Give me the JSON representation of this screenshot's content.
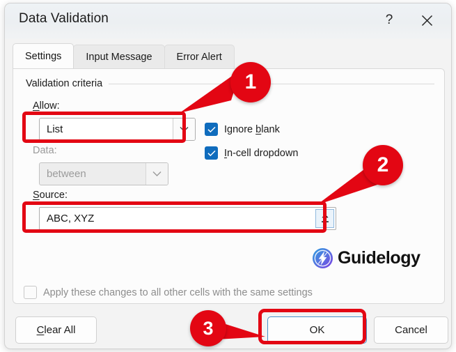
{
  "dialog": {
    "title": "Data Validation",
    "help_icon": "?",
    "help_icon_name": "help-icon",
    "close_icon": "close-icon"
  },
  "tabs": [
    {
      "label": "Settings",
      "active": true
    },
    {
      "label": "Input Message",
      "active": false
    },
    {
      "label": "Error Alert",
      "active": false
    }
  ],
  "settings": {
    "group_label": "Validation criteria",
    "allow": {
      "label": "Allow:",
      "accel": "A",
      "value": "List",
      "enabled": true
    },
    "data": {
      "label": "Data:",
      "value": "between",
      "enabled": false
    },
    "source": {
      "label": "Source:",
      "accel": "S",
      "value": "ABC, XYZ",
      "range_picker_icon": "collapse-dialog-icon"
    },
    "checkboxes": [
      {
        "label": "Ignore blank",
        "accel": "b",
        "checked": true,
        "enabled": true
      },
      {
        "label": "In-cell dropdown",
        "accel": "I",
        "checked": true,
        "enabled": true
      }
    ],
    "apply_all": {
      "label": "Apply these changes to all other cells with the same settings",
      "checked": false,
      "enabled": false
    }
  },
  "footer": {
    "clear_all": "Clear All",
    "ok": "OK",
    "cancel": "Cancel"
  },
  "watermark": {
    "text": "Guidelogy",
    "icon": "lightning-bolt-icon",
    "gradient_from": "#2f9fe0",
    "gradient_to": "#7b3fe4"
  },
  "annotations": {
    "accent_color": "#e30613",
    "steps": [
      {
        "number": "1",
        "target": "allow-dropdown"
      },
      {
        "number": "2",
        "target": "source-input"
      },
      {
        "number": "3",
        "target": "ok-button"
      }
    ]
  }
}
